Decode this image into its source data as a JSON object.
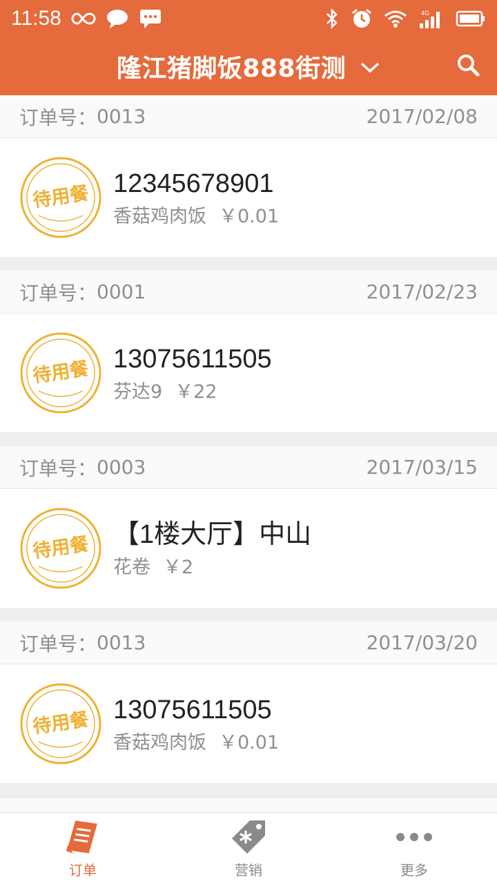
{
  "status": {
    "time": "11:58",
    "network": "4G"
  },
  "appbar": {
    "title": "隆江猪脚饭888街测",
    "dropdown_icon": "chevron-down-icon",
    "search_icon": "search-icon"
  },
  "orders": [
    {
      "label": "订单号：",
      "number": "0013",
      "date": "2017/02/08",
      "stamp": "待用餐",
      "customer": "12345678901",
      "dish": "香菇鸡肉饭",
      "price": "￥0.01"
    },
    {
      "label": "订单号：",
      "number": "0001",
      "date": "2017/02/23",
      "stamp": "待用餐",
      "customer": "13075611505",
      "dish": "芬达9",
      "price": "￥22"
    },
    {
      "label": "订单号：",
      "number": "0003",
      "date": "2017/03/15",
      "stamp": "待用餐",
      "customer": "【1楼大厅】中山",
      "dish": "花卷",
      "price": "￥2"
    },
    {
      "label": "订单号：",
      "number": "0013",
      "date": "2017/03/20",
      "stamp": "待用餐",
      "customer": "13075611505",
      "dish": "香菇鸡肉饭",
      "price": "￥0.01"
    }
  ],
  "tabs": [
    {
      "label": "订单",
      "icon": "order-icon",
      "active": true
    },
    {
      "label": "营销",
      "icon": "marketing-tag-icon",
      "active": false
    },
    {
      "label": "更多",
      "icon": "more-dots-icon",
      "active": false
    }
  ],
  "colors": {
    "brand": "#e56a3c",
    "stamp": "#f0b030"
  }
}
